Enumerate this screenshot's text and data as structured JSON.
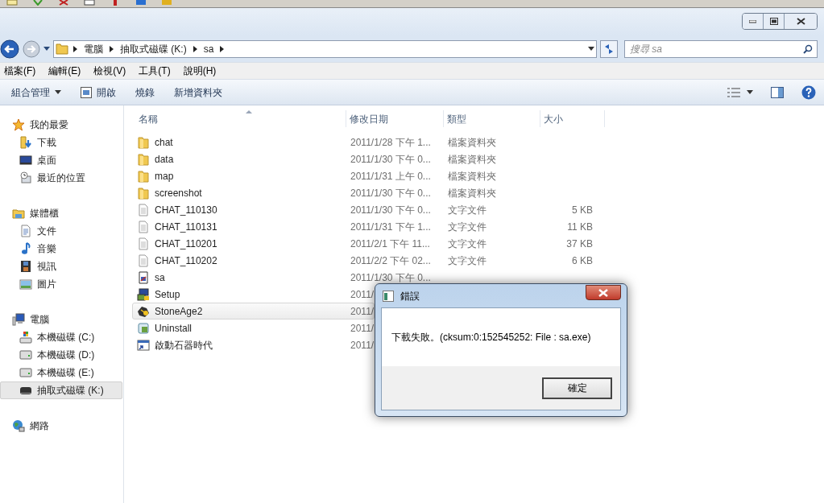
{
  "address": {
    "crumbs": [
      "電腦",
      "抽取式磁碟 (K:)",
      "sa"
    ],
    "search_placeholder": "搜尋 sa"
  },
  "menu": [
    "檔案(F)",
    "編輯(E)",
    "檢視(V)",
    "工具(T)",
    "說明(H)"
  ],
  "commands": [
    {
      "label": "組合管理",
      "kind": "dropdown"
    },
    {
      "label": "開啟",
      "kind": "icon"
    },
    {
      "label": "燒錄",
      "kind": "plain"
    },
    {
      "label": "新增資料夾",
      "kind": "plain"
    }
  ],
  "sidebar": [
    {
      "label": "我的最愛",
      "kind": "star",
      "selected": false,
      "children": [
        {
          "label": "下載",
          "kind": "download",
          "selected": false
        },
        {
          "label": "桌面",
          "kind": "desktop",
          "selected": false
        },
        {
          "label": "最近的位置",
          "kind": "recent",
          "selected": false
        }
      ]
    },
    {
      "label": "媒體櫃",
      "kind": "library",
      "selected": false,
      "children": [
        {
          "label": "文件",
          "kind": "document",
          "selected": false
        },
        {
          "label": "音樂",
          "kind": "music",
          "selected": false
        },
        {
          "label": "視訊",
          "kind": "video",
          "selected": false
        },
        {
          "label": "圖片",
          "kind": "picture",
          "selected": false
        }
      ]
    },
    {
      "label": "電腦",
      "kind": "computer",
      "selected": false,
      "children": [
        {
          "label": "本機磁碟 (C:)",
          "kind": "sysdrive",
          "selected": false
        },
        {
          "label": "本機磁碟 (D:)",
          "kind": "drive",
          "selected": false
        },
        {
          "label": "本機磁碟 (E:)",
          "kind": "drive",
          "selected": false
        },
        {
          "label": "抽取式磁碟 (K:)",
          "kind": "removable",
          "selected": true
        }
      ]
    },
    {
      "label": "網路",
      "kind": "network",
      "selected": false
    }
  ],
  "table": {
    "columns": [
      "名稱",
      "修改日期",
      "類型",
      "大小"
    ],
    "rows": [
      {
        "name": "chat",
        "date": "2011/1/28 下午 1...",
        "type": "檔案資料夾",
        "kind": "folder",
        "selected": false
      },
      {
        "name": "data",
        "date": "2011/1/30 下午 0...",
        "type": "檔案資料夾",
        "kind": "folder",
        "selected": false
      },
      {
        "name": "map",
        "date": "2011/1/31 上午 0...",
        "type": "檔案資料夾",
        "kind": "folder",
        "selected": false
      },
      {
        "name": "screenshot",
        "date": "2011/1/30 下午 0...",
        "type": "檔案資料夾",
        "kind": "folder",
        "selected": false
      },
      {
        "name": "CHAT_110130",
        "date": "2011/1/30 下午 0...",
        "type": "文字文件",
        "size": "5 KB",
        "kind": "text",
        "selected": false
      },
      {
        "name": "CHAT_110131",
        "date": "2011/1/31 下午 1...",
        "type": "文字文件",
        "size": "11 KB",
        "kind": "text",
        "selected": false
      },
      {
        "name": "CHAT_110201",
        "date": "2011/2/1 下午 11...",
        "type": "文字文件",
        "size": "37 KB",
        "kind": "text",
        "selected": false
      },
      {
        "name": "CHAT_110202",
        "date": "2011/2/2 下午 02...",
        "type": "文字文件",
        "size": "6 KB",
        "kind": "text",
        "selected": false
      },
      {
        "name": "sa",
        "date": "2011/1/30 下午 0...",
        "kind": "app",
        "selected": false
      },
      {
        "name": "Setup",
        "date": "2011/",
        "kind": "setup",
        "selected": false
      },
      {
        "name": "StoneAge2",
        "date": "2011/",
        "kind": "game",
        "selected": true
      },
      {
        "name": "Uninstall",
        "date": "2011/",
        "kind": "uninstall",
        "selected": false
      },
      {
        "name": "啟動石器時代",
        "date": "2011/",
        "kind": "shortcut",
        "selected": false
      }
    ]
  },
  "dialog": {
    "title": "錯誤",
    "message": "下載失敗。(cksum:0:152545252: File : sa.exe)",
    "button": "確定"
  }
}
